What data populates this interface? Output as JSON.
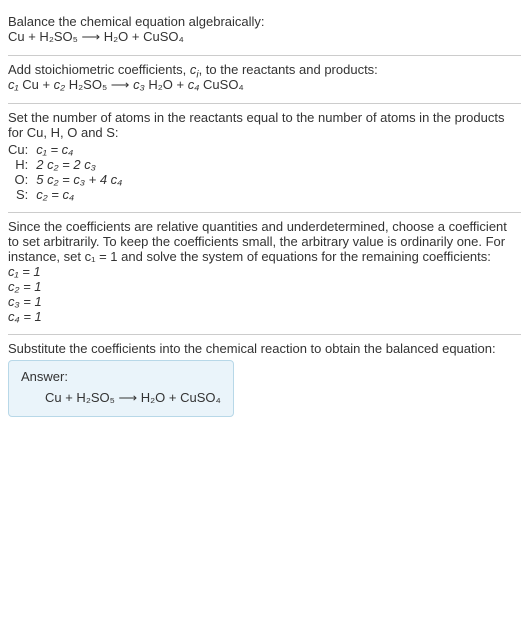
{
  "section1": {
    "line1": "Balance the chemical equation algebraically:",
    "eq": "Cu + H₂SO₅  ⟶  H₂O + CuSO₄"
  },
  "section2": {
    "line1_a": "Add stoichiometric coefficients, ",
    "line1_b": "c",
    "line1_c": "i",
    "line1_d": ", to the reactants and products:",
    "eq_c1": "c₁",
    "eq_cu": " Cu + ",
    "eq_c2": "c₂",
    "eq_h2so5": " H₂SO₅  ⟶  ",
    "eq_c3": "c₃",
    "eq_h2o": " H₂O + ",
    "eq_c4": "c₄",
    "eq_cuso4": " CuSO₄"
  },
  "section3": {
    "line1": "Set the number of atoms in the reactants equal to the number of atoms in the products for Cu, H, O and S:",
    "rows": [
      {
        "el": "Cu:",
        "eq": "c₁ = c₄"
      },
      {
        "el": "H:",
        "eq": "2 c₂ = 2 c₃"
      },
      {
        "el": "O:",
        "eq": "5 c₂ = c₃ + 4 c₄"
      },
      {
        "el": "S:",
        "eq": "c₂ = c₄"
      }
    ]
  },
  "section4": {
    "line1": "Since the coefficients are relative quantities and underdetermined, choose a coefficient to set arbitrarily. To keep the coefficients small, the arbitrary value is ordinarily one. For instance, set c₁ = 1 and solve the system of equations for the remaining coefficients:",
    "sol": [
      "c₁ = 1",
      "c₂ = 1",
      "c₃ = 1",
      "c₄ = 1"
    ]
  },
  "section5": {
    "line1": "Substitute the coefficients into the chemical reaction to obtain the balanced equation:",
    "answer_title": "Answer:",
    "answer_eq": "Cu + H₂SO₅  ⟶  H₂O + CuSO₄"
  },
  "chart_data": {
    "type": "table",
    "title": "Atom balance equations",
    "rows": [
      {
        "element": "Cu",
        "equation": "c1 = c4"
      },
      {
        "element": "H",
        "equation": "2 c2 = 2 c3"
      },
      {
        "element": "O",
        "equation": "5 c2 = c3 + 4 c4"
      },
      {
        "element": "S",
        "equation": "c2 = c4"
      }
    ],
    "solution": {
      "c1": 1,
      "c2": 1,
      "c3": 1,
      "c4": 1
    }
  }
}
